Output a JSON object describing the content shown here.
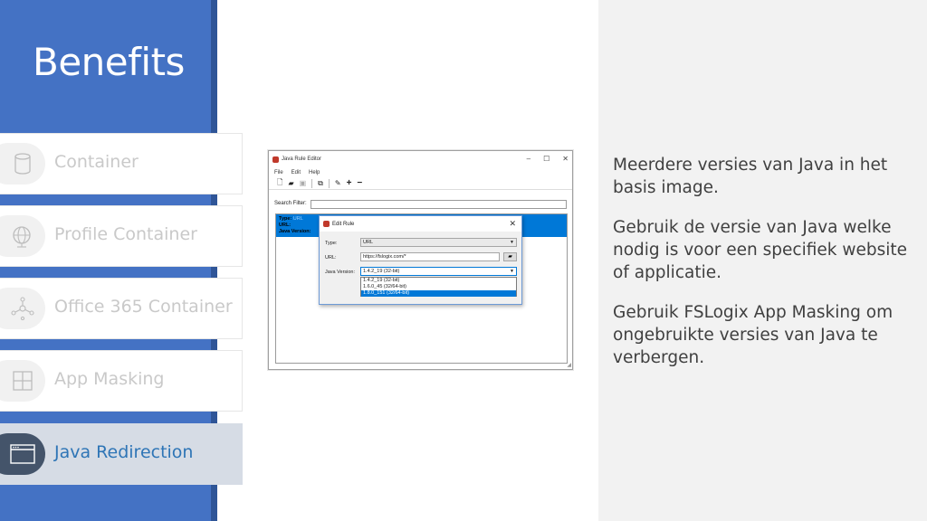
{
  "slide": {
    "title": "Benefits",
    "nav_items": [
      {
        "label": "Container",
        "icon": "database-icon"
      },
      {
        "label": "Profile Container",
        "icon": "globe-icon"
      },
      {
        "label": "Office 365 Container",
        "icon": "network-icon"
      },
      {
        "label": "App Masking",
        "icon": "grid-icon"
      },
      {
        "label": "Java Redirection",
        "icon": "window-icon",
        "active": true
      }
    ],
    "paragraphs": [
      "Meerdere versies van Java in het basis image.",
      "Gebruik de versie van Java welke nodig is voor een specifiek website of applicatie.",
      "Gebruik FSLogix App Masking om ongebruikte versies van Java te verbergen."
    ]
  },
  "editor": {
    "window_title": "Java Rule Editor",
    "menu": [
      "File",
      "Edit",
      "Help"
    ],
    "search_label": "Search Filter:",
    "rule": {
      "type_label": "Type:",
      "type_value": "URL",
      "url_label": "URL:",
      "java_label": "Java Version:"
    },
    "dialog": {
      "title": "Edit Rule",
      "type_label": "Type:",
      "type_value": "URL",
      "url_label": "URL:",
      "url_value": "https://fslogix.com/*",
      "java_label": "Java Version:",
      "java_value": "1.4.2_19 (32-bit)",
      "options": [
        "1.4.2_19 (32-bit)",
        "1.6.0_45 (32/64-bit)",
        "1.8.0_151 (32/64-bit)"
      ]
    }
  },
  "colors": {
    "left_panel": "#4472c4",
    "active_item_bg": "#d6dce5",
    "active_label": "#2e75b6",
    "selection_blue": "#0078d7"
  }
}
